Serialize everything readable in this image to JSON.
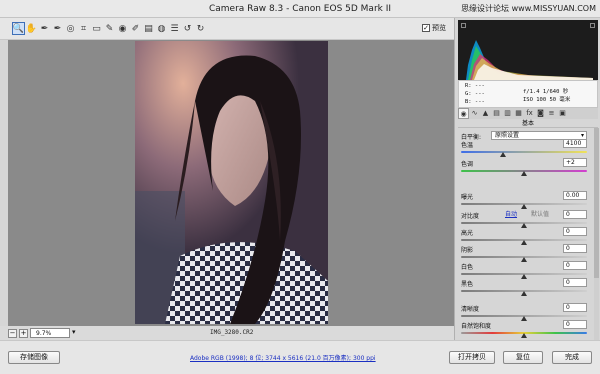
{
  "window": {
    "title": "Camera Raw 8.3 -  Canon EOS 5D Mark II",
    "watermark": "思缘设计论坛 www.MISSYUAN.COM"
  },
  "toolbar": {
    "tools": [
      {
        "icon": "zoom-icon",
        "glyph": "🔍",
        "active": true
      },
      {
        "icon": "hand-icon",
        "glyph": "✋"
      },
      {
        "icon": "white-balance-icon",
        "glyph": "✒"
      },
      {
        "icon": "color-sampler-icon",
        "glyph": "✒"
      },
      {
        "icon": "targeted-adjustment-icon",
        "glyph": "◎"
      },
      {
        "icon": "crop-icon",
        "glyph": "⌗"
      },
      {
        "icon": "straighten-icon",
        "glyph": "▭"
      },
      {
        "icon": "spot-removal-icon",
        "glyph": "✎"
      },
      {
        "icon": "red-eye-icon",
        "glyph": "◉"
      },
      {
        "icon": "adjustment-brush-icon",
        "glyph": "✐"
      },
      {
        "icon": "graduated-filter-icon",
        "glyph": "▤"
      },
      {
        "icon": "radial-filter-icon",
        "glyph": "◍"
      },
      {
        "icon": "preferences-icon",
        "glyph": "☰"
      },
      {
        "icon": "rotate-left-icon",
        "glyph": "↺"
      },
      {
        "icon": "rotate-right-icon",
        "glyph": "↻"
      }
    ],
    "preview_label": "预览",
    "preview_checked": true
  },
  "status": {
    "zoom_value": "9.7%",
    "filename": "IMG_3280.CR2"
  },
  "bottom": {
    "save_label": "存储图像",
    "workflow_text": "Adobe RGB (1998); 8 位; 3744 x 5616 (21.0 百万像素); 300 ppi",
    "open_label": "打开拷贝",
    "reset_label": "复位",
    "done_label": "完成"
  },
  "readout": {
    "r": "R:  ---",
    "g": "G:  ---",
    "b": "B:  ---",
    "aperture_shutter": "f/1.4   1/640 秒",
    "iso_lens": "ISO 100   50 毫米"
  },
  "panel": {
    "tabs": [
      {
        "icon": "basic-tab-icon",
        "glyph": "◉",
        "active": true
      },
      {
        "icon": "tone-curve-tab-icon",
        "glyph": "∿"
      },
      {
        "icon": "detail-tab-icon",
        "glyph": "▲"
      },
      {
        "icon": "hsl-tab-icon",
        "glyph": "▤"
      },
      {
        "icon": "split-toning-tab-icon",
        "glyph": "▥"
      },
      {
        "icon": "lens-tab-icon",
        "glyph": "▦"
      },
      {
        "icon": "effects-tab-icon",
        "glyph": "fx"
      },
      {
        "icon": "camera-calibration-tab-icon",
        "glyph": "◙"
      },
      {
        "icon": "presets-tab-icon",
        "glyph": "≡"
      },
      {
        "icon": "snapshots-tab-icon",
        "glyph": "▣"
      }
    ],
    "section_title": "基本",
    "white_balance_label": "白平衡:",
    "white_balance_value": "原照设置",
    "auto_label": "自动",
    "default_label": "默认值",
    "sliders": [
      {
        "label": "色温",
        "value": "4100",
        "fraction": 0.33,
        "track": "temp"
      },
      {
        "label": "色调",
        "value": "+2",
        "fraction": 0.5,
        "track": "tint"
      },
      {
        "label": "曝光",
        "value": "0.00",
        "fraction": 0.5,
        "track": "gray"
      },
      {
        "label": "对比度",
        "value": "0",
        "fraction": 0.5,
        "track": "gray"
      },
      {
        "label": "高光",
        "value": "0",
        "fraction": 0.5,
        "track": "gray"
      },
      {
        "label": "阴影",
        "value": "0",
        "fraction": 0.5,
        "track": "gray"
      },
      {
        "label": "白色",
        "value": "0",
        "fraction": 0.5,
        "track": "gray"
      },
      {
        "label": "黑色",
        "value": "0",
        "fraction": 0.5,
        "track": "gray"
      },
      {
        "label": "清晰度",
        "value": "0",
        "fraction": 0.5,
        "track": "gray"
      },
      {
        "label": "自然饱和度",
        "value": "0",
        "fraction": 0.5,
        "track": "sat"
      }
    ]
  }
}
